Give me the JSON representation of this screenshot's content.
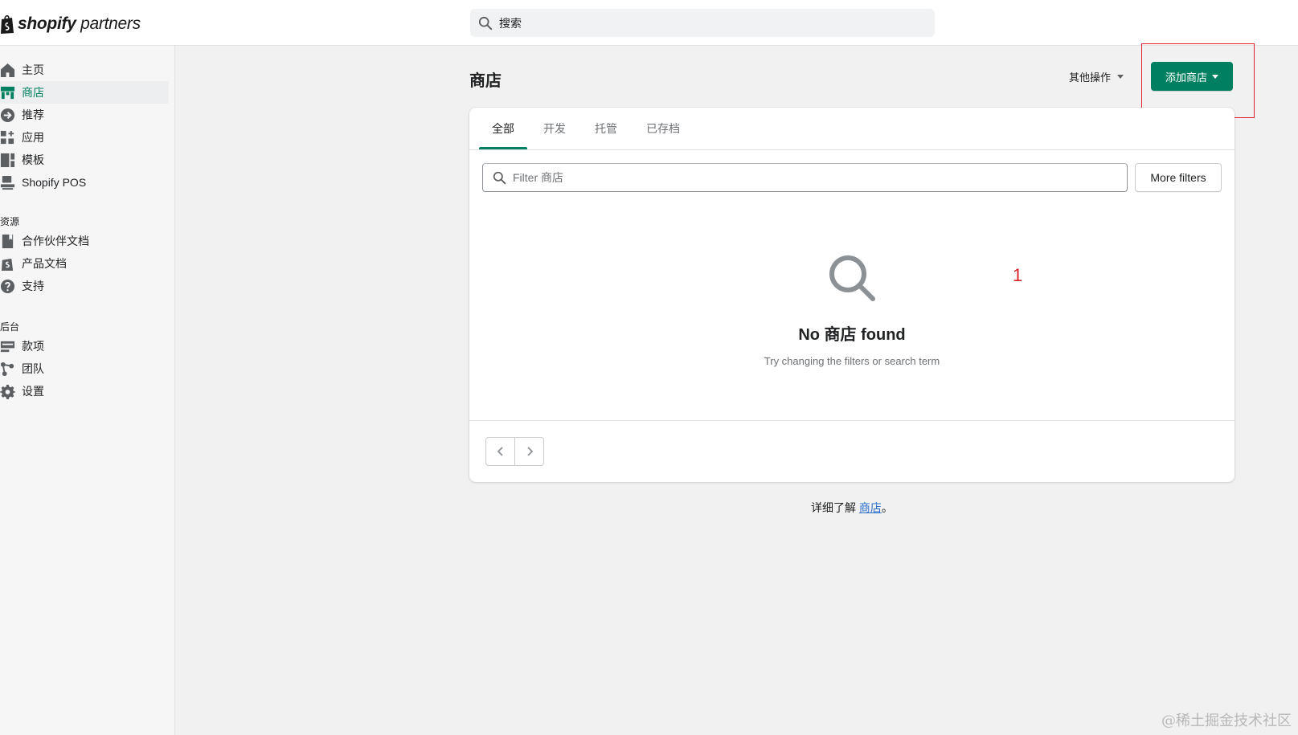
{
  "header": {
    "logo_bold": "shopify",
    "logo_light": "partners",
    "search_placeholder": "搜索"
  },
  "sidebar": {
    "items": [
      {
        "label": "主页",
        "icon": "home-icon"
      },
      {
        "label": "商店",
        "icon": "store-icon",
        "active": true
      },
      {
        "label": "推荐",
        "icon": "referral-icon"
      },
      {
        "label": "应用",
        "icon": "apps-icon"
      },
      {
        "label": "模板",
        "icon": "themes-icon"
      },
      {
        "label": "Shopify POS",
        "icon": "pos-icon"
      }
    ],
    "resources_title": "资源",
    "resources": [
      {
        "label": "合作伙伴文档",
        "icon": "book-icon"
      },
      {
        "label": "产品文档",
        "icon": "shopify-bag-icon"
      },
      {
        "label": "支持",
        "icon": "question-icon"
      }
    ],
    "backend_title": "后台",
    "backend": [
      {
        "label": "款项",
        "icon": "payouts-icon"
      },
      {
        "label": "团队",
        "icon": "team-icon"
      },
      {
        "label": "设置",
        "icon": "gear-icon"
      }
    ]
  },
  "main": {
    "title": "商店",
    "more_actions": "其他操作",
    "add_store": "添加商店",
    "tabs": [
      "全部",
      "开发",
      "托管",
      "已存档"
    ],
    "filter_placeholder": "Filter 商店",
    "more_filters": "More filters",
    "empty_title": "No 商店 found",
    "empty_subtitle": "Try changing the filters or search term",
    "learn_prefix": "详细了解 ",
    "learn_link": "商店",
    "learn_suffix": "。"
  },
  "annotation": {
    "number": "1"
  },
  "watermark": "@稀土掘金技术社区",
  "colors": {
    "accent": "#008060",
    "highlight": "#e0202e",
    "link": "#2c6ecb"
  }
}
